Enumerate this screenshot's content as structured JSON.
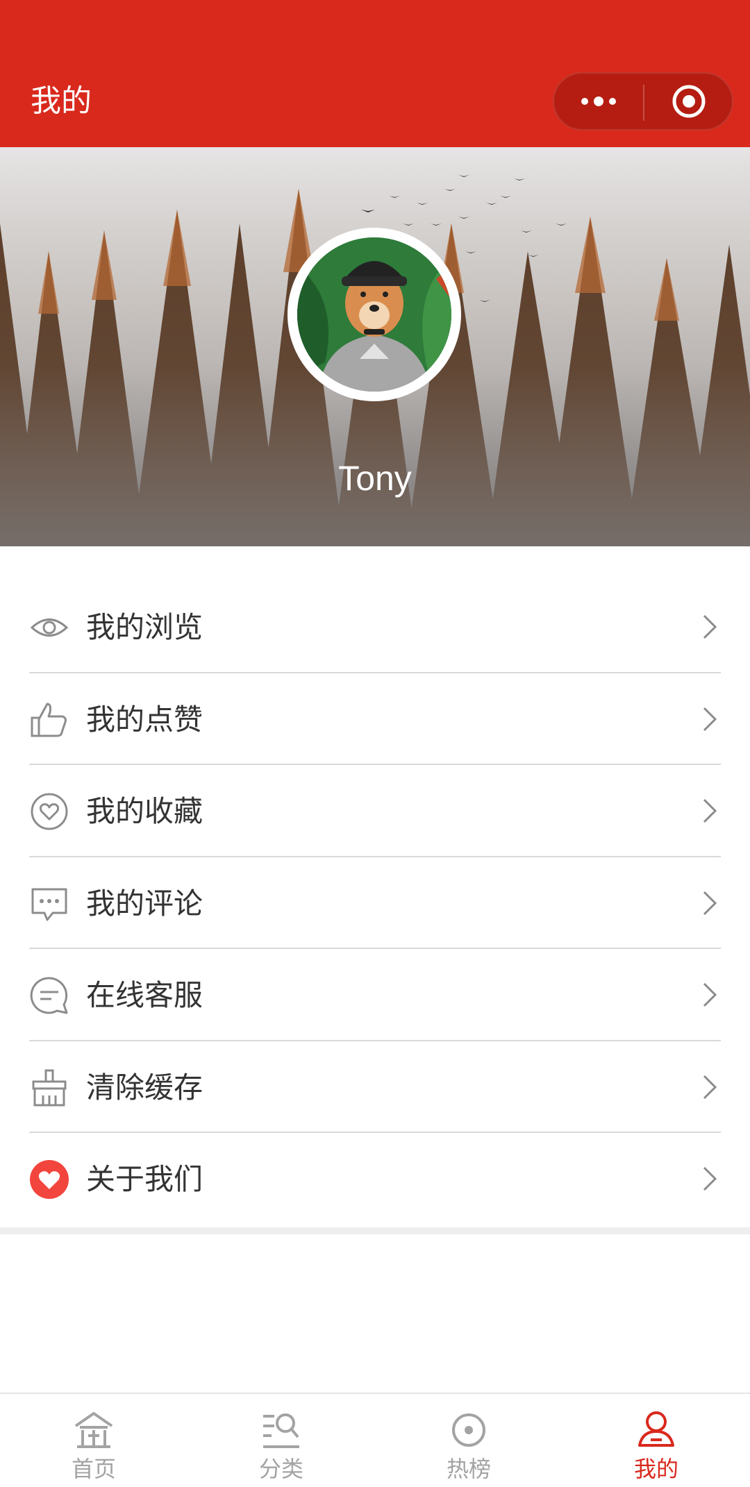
{
  "header": {
    "title": "我的",
    "bg_color": "#d9291d",
    "capsule": {
      "more_icon": "more-dots-icon",
      "close_icon": "target-circle-icon"
    }
  },
  "profile": {
    "username": "Tony",
    "avatar_icon": "avatar-image",
    "banner": "forest-banner"
  },
  "menu": [
    {
      "label": "我的浏览",
      "icon": "eye-icon"
    },
    {
      "label": "我的点赞",
      "icon": "thumbs-up-icon"
    },
    {
      "label": "我的收藏",
      "icon": "heart-outline-icon"
    },
    {
      "label": "我的评论",
      "icon": "comment-icon"
    },
    {
      "label": "在线客服",
      "icon": "chat-bubble-icon"
    },
    {
      "label": "清除缓存",
      "icon": "broom-icon"
    },
    {
      "label": "关于我们",
      "icon": "heart-filled-icon"
    }
  ],
  "tabbar": {
    "active_color": "#d9291d",
    "inactive_color": "#a3a3a3",
    "tabs": [
      {
        "label": "首页",
        "icon": "home-icon",
        "active": false
      },
      {
        "label": "分类",
        "icon": "category-search-icon",
        "active": false
      },
      {
        "label": "热榜",
        "icon": "hot-circle-icon",
        "active": false
      },
      {
        "label": "我的",
        "icon": "user-icon",
        "active": true
      }
    ]
  }
}
